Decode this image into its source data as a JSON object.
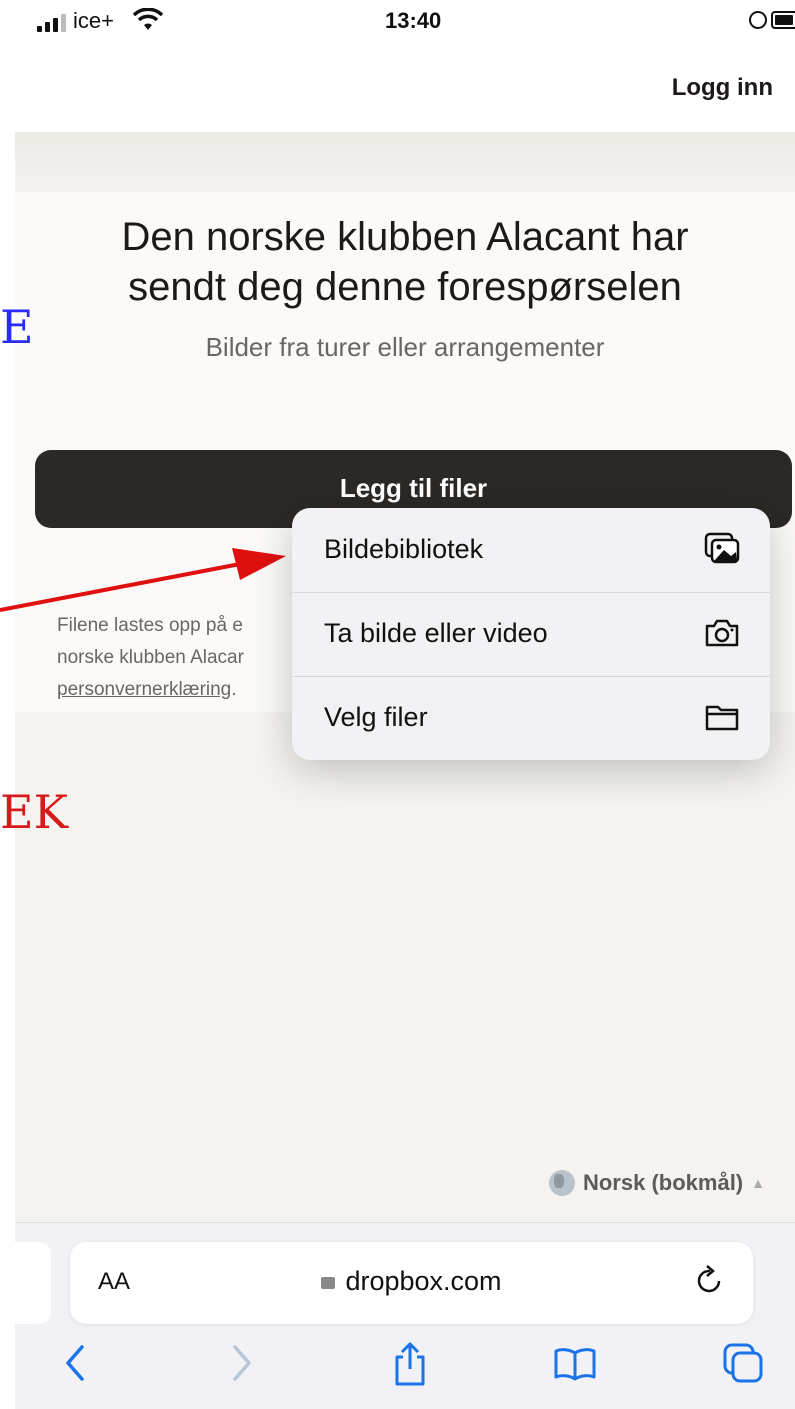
{
  "status_bar": {
    "carrier": "ice+",
    "time": "13:40"
  },
  "header": {
    "login_label": "Logg inn"
  },
  "request": {
    "title_line1": "Den norske klubben Alacant har",
    "title_line2": "sendt deg denne forespørselen",
    "subtitle": "Bilder fra turer eller arrangementer",
    "add_files_label": "Legg til filer",
    "footnote_line1": "Filene lastes opp på e",
    "footnote_line2": "norske klubben Alacar",
    "footnote_link": "personvernerklæring",
    "footnote_period": "."
  },
  "menu": {
    "items": [
      {
        "label": "Bildebibliotek",
        "icon": "photo-library-icon"
      },
      {
        "label": "Ta bilde eller video",
        "icon": "camera-icon"
      },
      {
        "label": "Velg filer",
        "icon": "folder-icon"
      }
    ]
  },
  "annotations": {
    "blue_fragment": "E",
    "red_fragment": "EK",
    "arrow_color": "#e01010"
  },
  "language": {
    "label": "Norsk (bokmål)"
  },
  "safari": {
    "text_size_label": "AA",
    "domain": "dropbox.com"
  },
  "colors": {
    "button_bg": "#2b2826",
    "page_bg": "#f5f3f0"
  }
}
